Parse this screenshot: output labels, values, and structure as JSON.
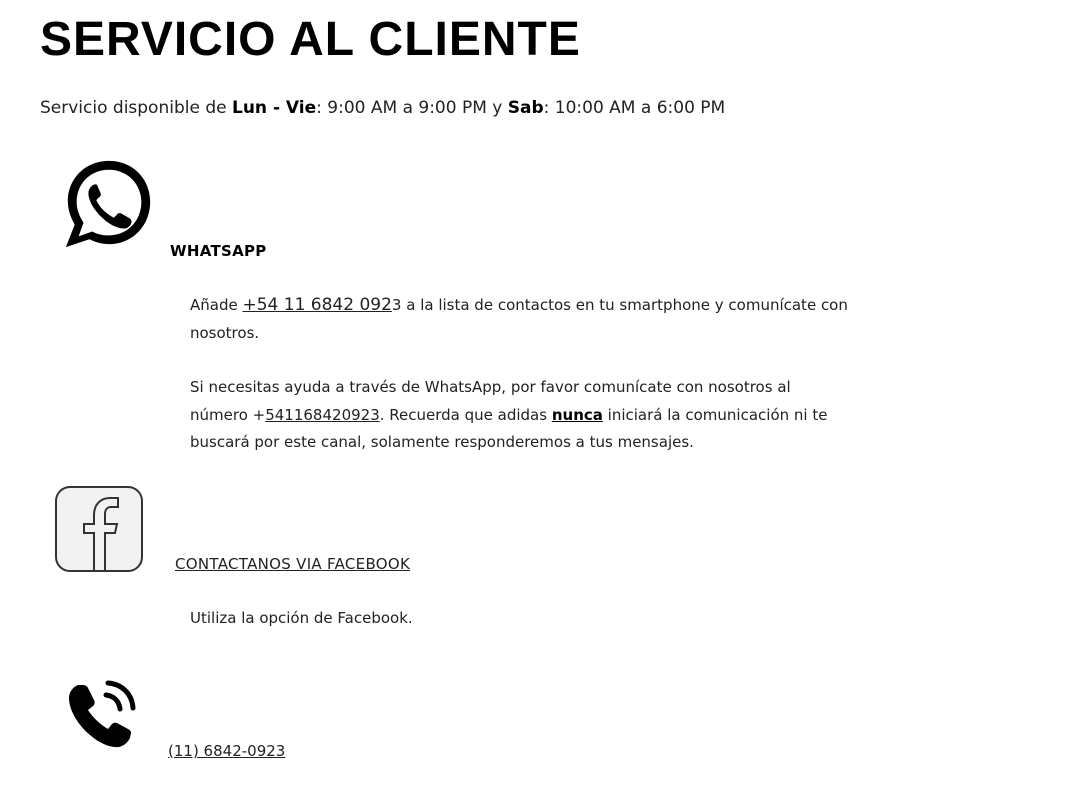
{
  "header": {
    "title": "SERVICIO AL CLIENTE"
  },
  "hours": {
    "prefix": "Servicio disponible de ",
    "weekday_label": "Lun - Vie",
    "weekday_hours": ": 9:00 AM a 9:00 PM y ",
    "saturday_label": "Sab",
    "saturday_hours": ": 10:00 AM a 6:00 PM"
  },
  "whatsapp": {
    "icon": "whatsapp-icon",
    "title": "WHATSAPP",
    "p1_before": "Añade ",
    "p1_link": "+54 11 6842 092",
    "p1_after": "3 a la lista de contactos en tu smartphone y comunícate con nosotros.",
    "p2_a": "Si necesitas ayuda a través de WhatsApp, por favor comunícate con nosotros al número +",
    "p2_link": "541168420923",
    "p2_b": ". Recuerda que adidas ",
    "p2_emph": "nunca",
    "p2_c": " iniciará la comunicación ni te buscará por este canal, solamente responderemos a tus mensajes."
  },
  "facebook": {
    "icon": "facebook-icon",
    "link": "CONTACTANOS VIA FACEBOOK",
    "text": "Utiliza la opción de Facebook."
  },
  "phone": {
    "icon": "phone-icon",
    "link": "(11) 6842-0923"
  }
}
